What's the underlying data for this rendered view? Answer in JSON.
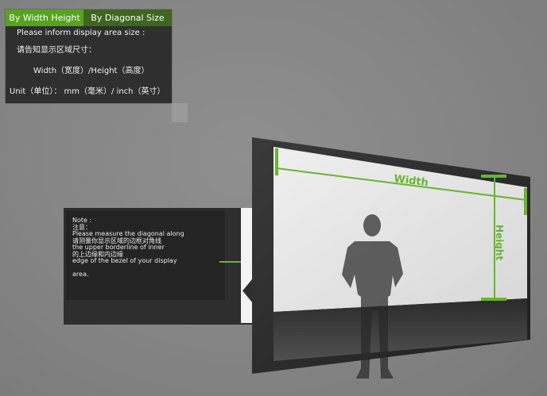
{
  "tabs": [
    {
      "label": "By Width Height",
      "active": true
    },
    {
      "label": "By Diagonal Size",
      "active": false
    }
  ],
  "panel": {
    "line1": "Please inform display area size :",
    "line2": "请告知显示区域尺寸：",
    "line3": "Width（宽度）/Height（高度）",
    "line4": "Unit（单位）：   mm（毫米）/ inch（英寸）"
  },
  "note": {
    "lines": [
      "Note :",
      "注意：",
      "Please measure the diagonal along",
      "请测量你显示区域的边框对角线",
      "the upper borderline of inner",
      "的上边缘和内边缘",
      "edge of the bezel of your display",
      "",
      "area."
    ]
  },
  "labels": {
    "width": "Width",
    "height": "Height"
  },
  "colors": {
    "accent_green": "#57a21f",
    "tab_inactive": "#3e661f",
    "panel_dark": "#2f2f2f",
    "measure_green": "#67b52f"
  },
  "icons": {
    "note_arrow": "arrow-right-icon",
    "person": "person-silhouette"
  }
}
